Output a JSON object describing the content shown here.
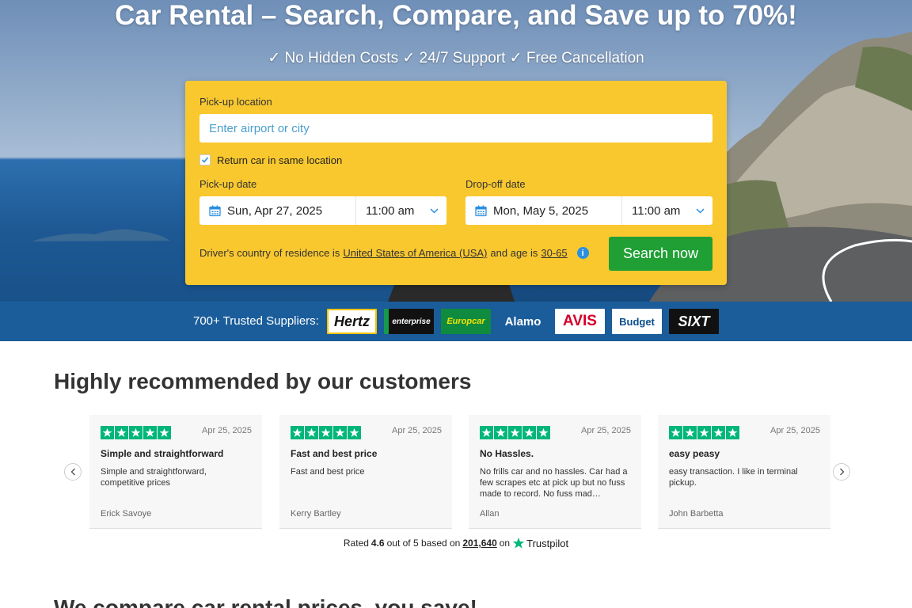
{
  "hero": {
    "title": "Car Rental – Search, Compare, and Save up to 70%!",
    "subtitle": "✓ No Hidden Costs ✓ 24/7 Support ✓ Free Cancellation"
  },
  "search": {
    "pickup_location_label": "Pick-up location",
    "pickup_location_placeholder": "Enter airport or city",
    "return_same_label": "Return car in same location",
    "return_same_checked": true,
    "pickup_date_label": "Pick-up date",
    "pickup_date": "Sun, Apr 27, 2025",
    "pickup_time": "11:00 am",
    "dropoff_date_label": "Drop-off date",
    "dropoff_date": "Mon, May 5, 2025",
    "dropoff_time": "11:00 am",
    "country_prefix": "Driver's country of residence is",
    "country": "United States of America (USA)",
    "age_prefix": "and age is",
    "age": "30-65",
    "button": "Search now"
  },
  "suppliers": {
    "label": "700+ Trusted Suppliers:",
    "logos": [
      "Hertz",
      "enterprise",
      "Europcar",
      "Alamo",
      "AVIS",
      "Budget",
      "SIXT"
    ]
  },
  "reviews": {
    "title": "Highly recommended by our customers",
    "items": [
      {
        "date": "Apr 25, 2025",
        "title": "Simple and straightforward",
        "text": "Simple and straightforward, competitive prices",
        "author": "Erick Savoye"
      },
      {
        "date": "Apr 25, 2025",
        "title": "Fast and best price",
        "text": "Fast and best price",
        "author": "Kerry Bartley"
      },
      {
        "date": "Apr 25, 2025",
        "title": "No Hassles.",
        "text": "No frills car and no hassles. Car had a few scrapes etc at pick up but no fuss made to record. No fuss mad…",
        "author": "Allan"
      },
      {
        "date": "Apr 25, 2025",
        "title": "easy peasy",
        "text": "easy transaction. I like in terminal pickup.",
        "author": "John Barbetta"
      }
    ],
    "stars_per_review": 5,
    "rating_prefix": "Rated",
    "rating_value": "4.6",
    "rating_mid": "out of 5 based on",
    "rating_count": "201,640",
    "rating_suffix": "on",
    "trustpilot": "Trustpilot"
  },
  "bottom": {
    "title": "We compare car rental prices, you save!"
  },
  "colors": {
    "search_box": "#f9c82f",
    "search_button": "#1f9f34",
    "suppliers_bar": "#1a5d9a",
    "trustpilot_green": "#00b67a"
  }
}
